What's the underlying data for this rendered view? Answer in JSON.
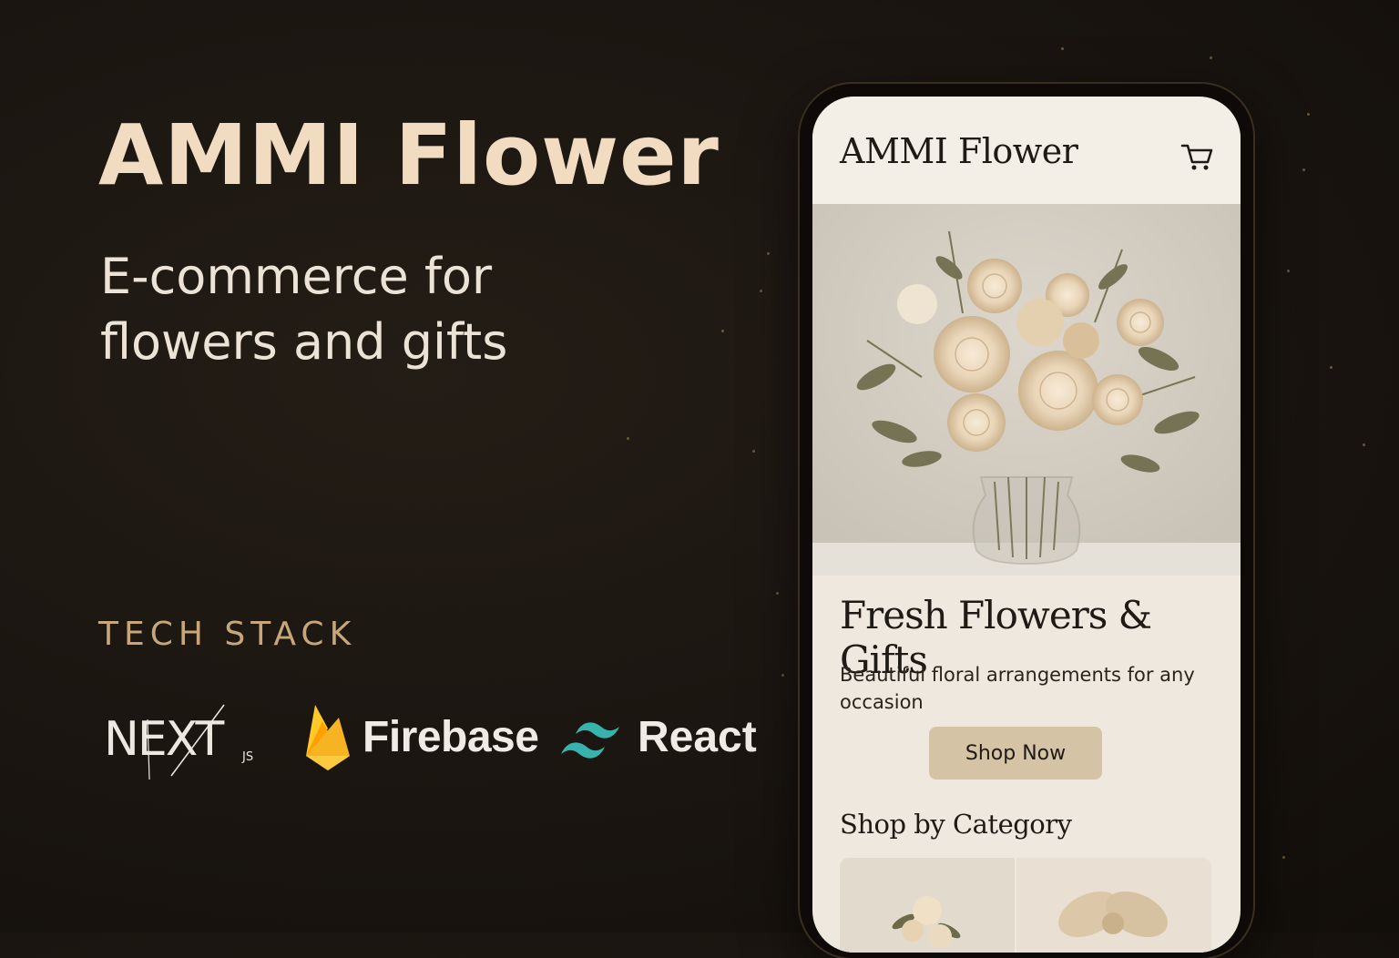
{
  "hero": {
    "title": "AMMI Flower",
    "subtitle_line1": "E-commerce for",
    "subtitle_line2": "flowers and gifts"
  },
  "tech_stack": {
    "label": "TECH STACK",
    "logos": [
      {
        "name": "NEXT",
        "suffix": "JS",
        "icon": "nextjs-icon"
      },
      {
        "name": "Firebase",
        "icon": "firebase-flame-icon",
        "color": "#f5b324"
      },
      {
        "name": "React",
        "icon": "tailwind-wave-icon",
        "color": "#38b2ac"
      }
    ]
  },
  "phone_app": {
    "header": {
      "title": "AMMI Flower",
      "cart_icon": "cart-icon"
    },
    "hero_section": {
      "heading": "Fresh Flowers & Gifts",
      "description": "Beautiful floral arrangements for any occasion",
      "cta_label": "Shop Now"
    },
    "categories": {
      "heading": "Shop by Category"
    }
  },
  "colors": {
    "background": "#1a1510",
    "title": "#f1dcc2",
    "accent": "#c8a67a",
    "screen_bg": "#efe8de",
    "button": "#d5c3a6"
  }
}
